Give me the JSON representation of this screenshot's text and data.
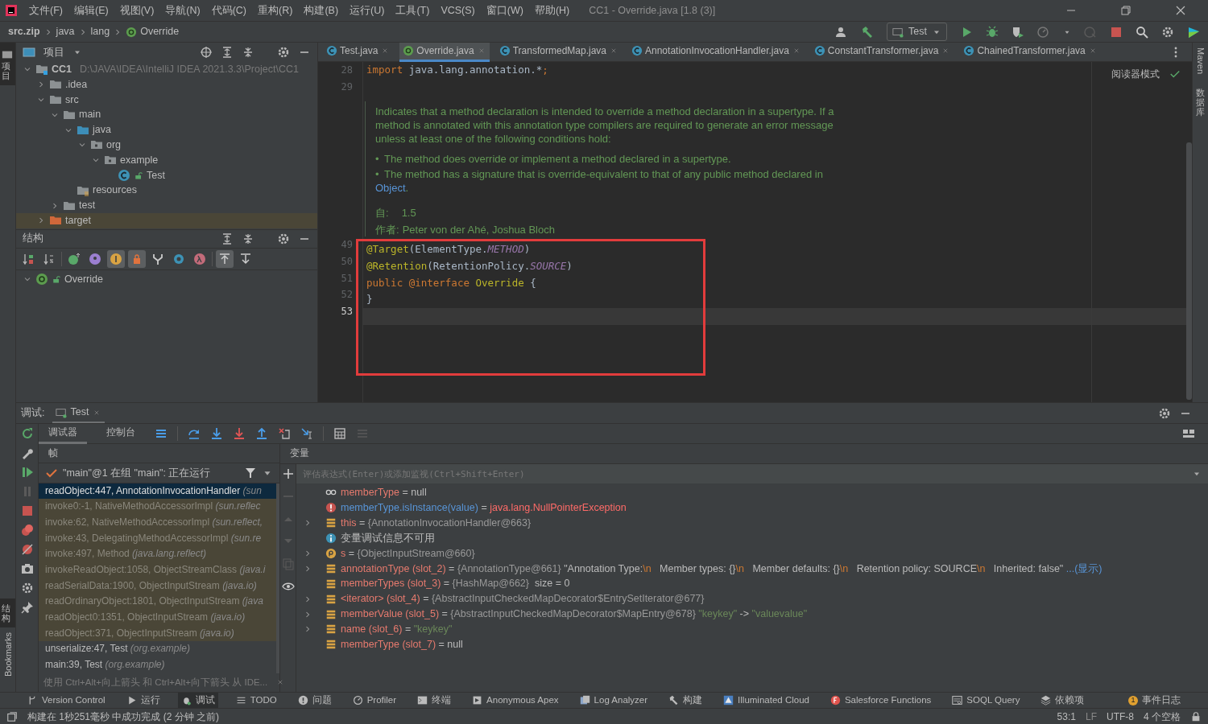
{
  "menu_bar": {
    "items": [
      "文件(F)",
      "编辑(E)",
      "视图(V)",
      "导航(N)",
      "代码(C)",
      "重构(R)",
      "构建(B)",
      "运行(U)",
      "工具(T)",
      "VCS(S)",
      "窗口(W)",
      "帮助(H)"
    ],
    "title": "CC1 - Override.java [1.8 (3)]"
  },
  "breadcrumbs": [
    {
      "label": "src.zip",
      "kind": "archive"
    },
    {
      "label": "java",
      "kind": "folder"
    },
    {
      "label": "lang",
      "kind": "folder"
    },
    {
      "label": "Override",
      "kind": "annotation"
    }
  ],
  "run_config": "Test",
  "left_stripe": [
    {
      "label": "项目",
      "kind": "cjk",
      "selected": true
    },
    {
      "label": "结构",
      "kind": "cjk",
      "selected": true
    },
    {
      "label": "Bookmarks",
      "kind": "latin",
      "selected": false
    }
  ],
  "right_stripe": [
    {
      "label": "Maven",
      "kind": "latin"
    },
    {
      "label": "数据库",
      "kind": "cjk"
    }
  ],
  "project_panel": {
    "title": "项目",
    "tree": [
      {
        "label": "CC1",
        "path": "D:\\JAVA\\IDEA\\IntelliJ IDEA 2021.3.3\\Project\\CC1",
        "kind": "module",
        "expanded": true,
        "children": [
          {
            "label": ".idea",
            "kind": "folder",
            "expanded": false
          },
          {
            "label": "src",
            "kind": "folder",
            "expanded": true,
            "children": [
              {
                "label": "main",
                "kind": "folder",
                "expanded": true,
                "children": [
                  {
                    "label": "java",
                    "kind": "source",
                    "expanded": true,
                    "children": [
                      {
                        "label": "org",
                        "kind": "package",
                        "expanded": true,
                        "children": [
                          {
                            "label": "example",
                            "kind": "package",
                            "expanded": true,
                            "children": [
                              {
                                "label": "Test",
                                "kind": "class"
                              }
                            ]
                          }
                        ]
                      }
                    ]
                  },
                  {
                    "label": "resources",
                    "kind": "resources"
                  }
                ]
              },
              {
                "label": "test",
                "kind": "folder",
                "expanded": false
              }
            ]
          },
          {
            "label": "target",
            "kind": "excluded",
            "expanded": false
          }
        ]
      }
    ]
  },
  "structure_panel": {
    "title": "结构",
    "toolbar": [
      {
        "kind": "sort-visibility",
        "on": false
      },
      {
        "kind": "sort-alpha",
        "on": false
      },
      {
        "kind": "inherited",
        "on": false
      },
      {
        "kind": "properties",
        "on": false
      },
      {
        "kind": "fields",
        "on": true
      },
      {
        "kind": "non-public",
        "on": true
      },
      {
        "kind": "hierarchy",
        "on": false
      },
      {
        "kind": "anonymous",
        "on": false
      },
      {
        "kind": "lambdas",
        "on": false
      },
      {
        "kind": "scroll-to",
        "on": true
      },
      {
        "kind": "scroll-from",
        "on": false
      }
    ],
    "tree": [
      {
        "label": "Override",
        "kind": "annotation",
        "expanded": true
      }
    ]
  },
  "editor": {
    "tabs": [
      {
        "label": "Test.java",
        "kind": "class",
        "selected": false
      },
      {
        "label": "Override.java",
        "kind": "annotation",
        "selected": true
      },
      {
        "label": "TransformedMap.java",
        "kind": "class",
        "selected": false
      },
      {
        "label": "AnnotationInvocationHandler.java",
        "kind": "class",
        "selected": false
      },
      {
        "label": "ConstantTransformer.java",
        "kind": "class",
        "selected": false
      },
      {
        "label": "ChainedTransformer.java",
        "kind": "class",
        "selected": false
      }
    ],
    "reader_mode": "阅读器模式",
    "lines_before": [
      {
        "number": "28",
        "current": false,
        "tokens": [
          {
            "text": "import",
            "kind": "keyword"
          },
          {
            "text": " java.lang.annotation.*",
            "kind": "plain"
          },
          {
            "text": ";",
            "kind": "keyword"
          }
        ]
      },
      {
        "number": "29",
        "current": false
      }
    ],
    "doc": {
      "paragraph": "Indicates that a method declaration is intended to override a method declaration in a supertype. If a method is annotated with this annotation type compilers are required to generate an error message unless at least one of the following conditions hold:",
      "bullets": [
        {
          "marker": "•",
          "text": "The method does override or implement a method declared in a supertype."
        },
        {
          "marker": "•",
          "text": "The method has a signature that is override-equivalent to that of any public method declared in",
          "link": "Object",
          "after": "."
        }
      ],
      "since_label": "自:",
      "since": "1.5",
      "author_label": "作者:",
      "author": "Peter von der Ahé, Joshua Bloch"
    },
    "lines_after": [
      {
        "number": "49",
        "current": false,
        "tokens": [
          {
            "text": "@Target",
            "kind": "annotation"
          },
          {
            "text": "(ElementType.",
            "kind": "plain"
          },
          {
            "text": "METHOD",
            "kind": "constant"
          },
          {
            "text": ")",
            "kind": "plain"
          }
        ]
      },
      {
        "number": "50",
        "current": false,
        "tokens": [
          {
            "text": "@Retention",
            "kind": "annotation"
          },
          {
            "text": "(RetentionPolicy.",
            "kind": "plain"
          },
          {
            "text": "SOURCE",
            "kind": "constant"
          },
          {
            "text": ")",
            "kind": "plain"
          }
        ]
      },
      {
        "number": "51",
        "current": false,
        "tokens": [
          {
            "text": "public ",
            "kind": "keyword"
          },
          {
            "text": "@interface ",
            "kind": "keyword"
          },
          {
            "text": "Override",
            "kind": "annotation"
          },
          {
            "text": " {",
            "kind": "plain"
          }
        ]
      },
      {
        "number": "52",
        "current": false,
        "tokens": [
          {
            "text": "}",
            "kind": "plain"
          }
        ]
      },
      {
        "number": "53",
        "current": true
      }
    ]
  },
  "debug": {
    "label": "调试:",
    "session": "Test",
    "tabs": [
      {
        "label": "调试器",
        "selected": true
      },
      {
        "label": "控制台",
        "selected": false
      }
    ],
    "frames_title": "帧",
    "thread": "\"main\"@1 在组 \"main\": 正在运行",
    "frames": [
      {
        "method": "readObject:447, AnnotationInvocationHandler",
        "package": "(sun",
        "selected": true,
        "library": false
      },
      {
        "method": "invoke0:-1, NativeMethodAccessorImpl",
        "package": "(sun.reflec",
        "selected": false,
        "library": true
      },
      {
        "method": "invoke:62, NativeMethodAccessorImpl",
        "package": "(sun.reflect,",
        "selected": false,
        "library": true
      },
      {
        "method": "invoke:43, DelegatingMethodAccessorImpl",
        "package": "(sun.re",
        "selected": false,
        "library": true
      },
      {
        "method": "invoke:497, Method",
        "package": "(java.lang.reflect)",
        "selected": false,
        "library": true
      },
      {
        "method": "invokeReadObject:1058, ObjectStreamClass",
        "package": "(java.i",
        "selected": false,
        "library": true
      },
      {
        "method": "readSerialData:1900, ObjectInputStream",
        "package": "(java.io)",
        "selected": false,
        "library": true
      },
      {
        "method": "readOrdinaryObject:1801, ObjectInputStream",
        "package": "(java",
        "selected": false,
        "library": true
      },
      {
        "method": "readObject0:1351, ObjectInputStream",
        "package": "(java.io)",
        "selected": false,
        "library": true
      },
      {
        "method": "readObject:371, ObjectInputStream",
        "package": "(java.io)",
        "selected": false,
        "library": true
      },
      {
        "method": "unserialize:47, Test",
        "package": "(org.example)",
        "selected": false,
        "library": false
      },
      {
        "method": "main:39, Test",
        "package": "(org.example)",
        "selected": false,
        "library": false
      }
    ],
    "hint": "使用 Ctrl+Alt+向上箭头 和 Ctrl+Alt+向下箭头 从 IDE...",
    "variables_title": "变量",
    "eval_placeholder": "评估表达式(Enter)或添加监视(Ctrl+Shift+Enter)",
    "variables": [
      {
        "kind": "watch",
        "expandable": false,
        "name": "memberType",
        "segments": [
          {
            "text": " = ",
            "kind": "plain"
          },
          {
            "text": "null",
            "kind": "plain"
          }
        ]
      },
      {
        "kind": "error",
        "expandable": false,
        "name": "memberType.isInstance(value)",
        "segments": [
          {
            "text": " = ",
            "kind": "plain"
          },
          {
            "text": "java.lang.NullPointerException",
            "kind": "error"
          }
        ]
      },
      {
        "kind": "field",
        "expandable": true,
        "name": "this",
        "segments": [
          {
            "text": " = ",
            "kind": "plain"
          },
          {
            "text": "{AnnotationInvocationHandler@663}",
            "kind": "ref"
          }
        ]
      },
      {
        "kind": "info",
        "expandable": false,
        "name": "变量调试信息不可用"
      },
      {
        "kind": "param",
        "expandable": true,
        "name": "s",
        "segments": [
          {
            "text": " = ",
            "kind": "plain"
          },
          {
            "text": "{ObjectInputStream@660}",
            "kind": "ref"
          }
        ]
      },
      {
        "kind": "field",
        "expandable": true,
        "name": "annotationType (slot_2)",
        "segments": [
          {
            "text": " = ",
            "kind": "plain"
          },
          {
            "text": "{AnnotationType@661} ",
            "kind": "ref"
          },
          {
            "text": "\"Annotation Type:",
            "kind": "plain"
          },
          {
            "text": "\\n",
            "kind": "escape"
          },
          {
            "text": "   Member types: {}",
            "kind": "plain"
          },
          {
            "text": "\\n",
            "kind": "escape"
          },
          {
            "text": "   Member defaults: {}",
            "kind": "plain"
          },
          {
            "text": "\\n",
            "kind": "escape"
          },
          {
            "text": "   Retention policy: SOURCE",
            "kind": "plain"
          },
          {
            "text": "\\n",
            "kind": "escape"
          },
          {
            "text": "   Inherited: false\" ",
            "kind": "plain"
          },
          {
            "text": "...(显示)",
            "kind": "link"
          }
        ]
      },
      {
        "kind": "field",
        "expandable": false,
        "name": "memberTypes (slot_3)",
        "segments": [
          {
            "text": " = ",
            "kind": "plain"
          },
          {
            "text": "{HashMap@662}",
            "kind": "ref"
          },
          {
            "text": "  size = 0",
            "kind": "plain"
          }
        ]
      },
      {
        "kind": "field",
        "expandable": true,
        "name": "<iterator> (slot_4)",
        "segments": [
          {
            "text": " = ",
            "kind": "plain"
          },
          {
            "text": "{AbstractInputCheckedMapDecorator$EntrySetIterator@677}",
            "kind": "ref"
          }
        ]
      },
      {
        "kind": "field",
        "expandable": true,
        "name": "memberValue (slot_5)",
        "segments": [
          {
            "text": " = ",
            "kind": "plain"
          },
          {
            "text": "{AbstractInputCheckedMapDecorator$MapEntry@678} ",
            "kind": "ref"
          },
          {
            "text": "\"keykey\"",
            "kind": "string"
          },
          {
            "text": " -> ",
            "kind": "plain"
          },
          {
            "text": "\"valuevalue\"",
            "kind": "string"
          }
        ]
      },
      {
        "kind": "field",
        "expandable": true,
        "name": "name (slot_6)",
        "segments": [
          {
            "text": " = ",
            "kind": "plain"
          },
          {
            "text": "\"keykey\"",
            "kind": "string"
          }
        ]
      },
      {
        "kind": "field",
        "expandable": false,
        "name": "memberType (slot_7)",
        "segments": [
          {
            "text": " = ",
            "kind": "plain"
          },
          {
            "text": "null",
            "kind": "plain"
          }
        ]
      }
    ]
  },
  "tool_windows": [
    {
      "label": "Version Control",
      "selected": false
    },
    {
      "label": "运行",
      "selected": false
    },
    {
      "label": "调试",
      "selected": true
    },
    {
      "label": "TODO",
      "selected": false
    },
    {
      "label": "问题",
      "selected": false
    },
    {
      "label": "Profiler",
      "selected": false
    },
    {
      "label": "终端",
      "selected": false
    },
    {
      "label": "Anonymous Apex",
      "selected": false
    },
    {
      "label": "Log Analyzer",
      "selected": false
    },
    {
      "label": "构建",
      "selected": false
    },
    {
      "label": "Illuminated Cloud",
      "selected": false
    },
    {
      "label": "Salesforce Functions",
      "selected": false
    },
    {
      "label": "SOQL Query",
      "selected": false
    },
    {
      "label": "依赖项",
      "selected": false
    }
  ],
  "event_log": {
    "label": "事件日志",
    "count": "1"
  },
  "status_bar": {
    "message": "构建在 1秒251毫秒 中成功完成 (2 分钟 之前)",
    "position": "53:1",
    "line_separator": "LF",
    "encoding": "UTF-8",
    "indent": "4 个空格"
  }
}
